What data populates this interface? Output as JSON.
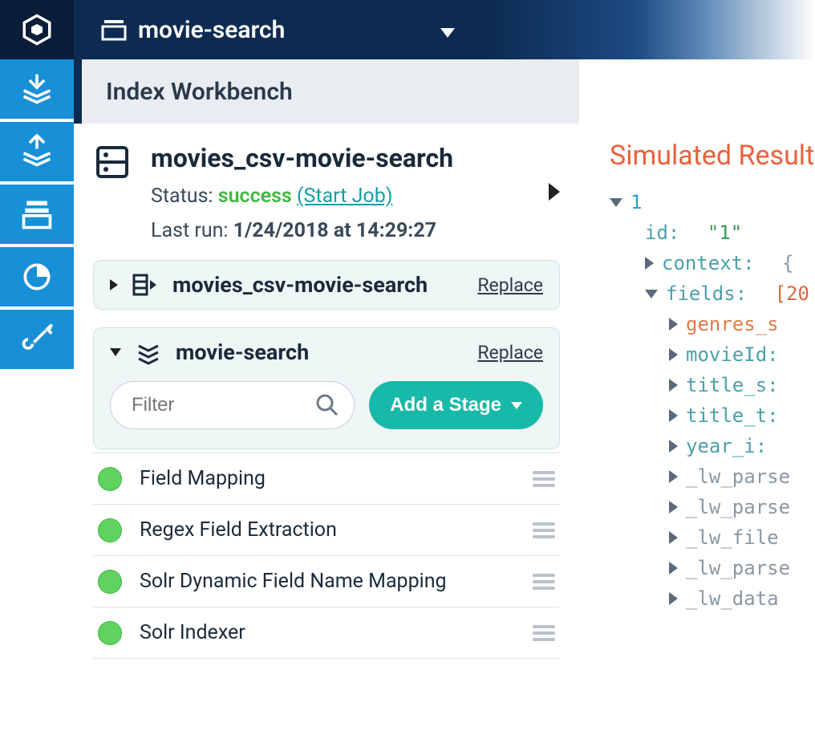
{
  "topbar": {
    "collection_name": "movie-search"
  },
  "breadcrumb": {
    "title": "Index Workbench"
  },
  "datasource": {
    "name": "movies_csv-movie-search",
    "status_label": "Status: ",
    "status_value": "success",
    "start_job": "(Start Job)",
    "last_run_label": "Last run: ",
    "last_run_value": "1/24/2018 at 14:29:27"
  },
  "cards": {
    "parser": {
      "name": "movies_csv-movie-search",
      "replace": "Replace"
    },
    "pipeline": {
      "name": "movie-search",
      "replace": "Replace",
      "filter_placeholder": "Filter",
      "add_stage": "Add a Stage",
      "stages": [
        "Field Mapping",
        "Regex Field Extraction",
        "Solr Dynamic Field Name Mapping",
        "Solr Indexer"
      ]
    }
  },
  "results": {
    "title": "Simulated Results",
    "doc_num": "1",
    "id_key": "id:",
    "id_val": "\"1\"",
    "context_key": "context:",
    "context_vf": "{",
    "fields_key": "fields:",
    "fields_vf": "[20",
    "field_rows": [
      "genres_s",
      "movieId:",
      "title_s:",
      "title_t:",
      "year_i:",
      "_lw_parse",
      "_lw_parse",
      "_lw_file",
      "_lw_parse",
      "_lw_data"
    ]
  }
}
